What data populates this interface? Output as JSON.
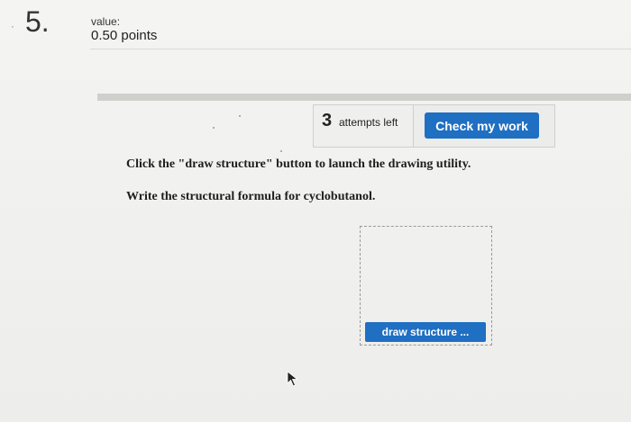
{
  "question": {
    "number": "5.",
    "value_label": "value:",
    "points": "0.50 points"
  },
  "attempts": {
    "count": "3",
    "text": "attempts left"
  },
  "check_button": {
    "label": "Check my work",
    "color": "#1f6fc2"
  },
  "instructions": [
    "Click the \"draw structure\" button to launch the drawing utility.",
    "Write the structural formula for cyclobutanol."
  ],
  "draw_button": {
    "label": "draw structure ..."
  },
  "icons": {
    "cursor": "mouse-pointer-icon"
  }
}
